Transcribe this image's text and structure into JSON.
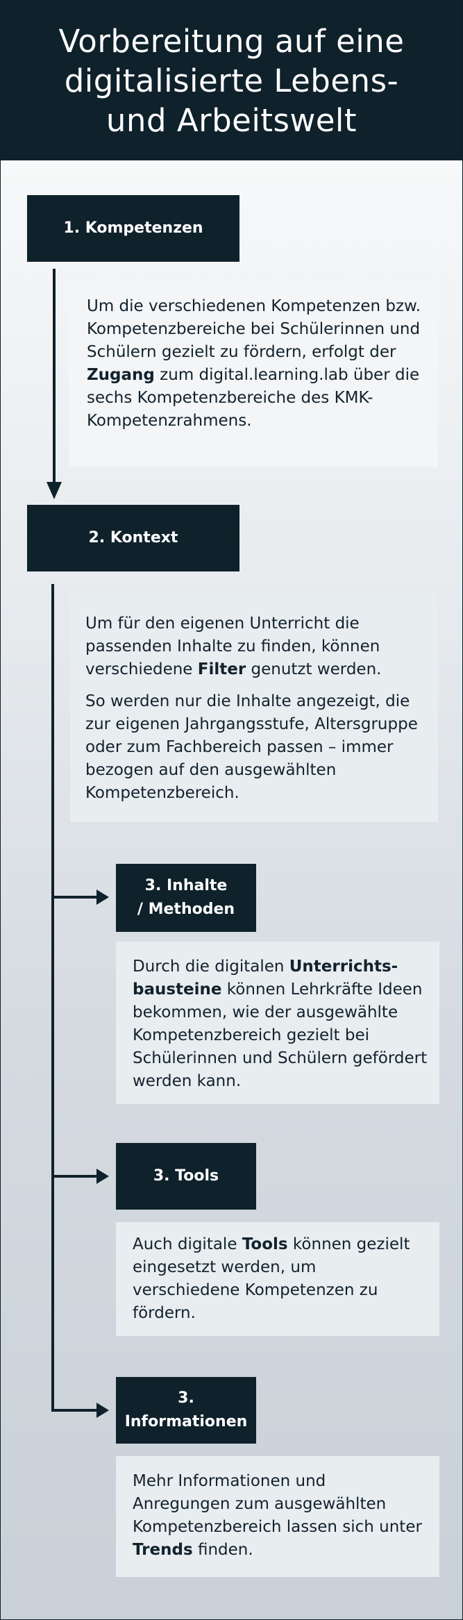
{
  "header": {
    "title": "Vorbereitung auf eine\ndigitalisierte Lebens-\nund Arbeitswelt"
  },
  "colors": {
    "dark": "#0f212b",
    "box": "#e8edf0",
    "text": "#12222c"
  },
  "steps": [
    {
      "label": "1. Kompetenzen",
      "paragraphs": [
        {
          "before": "Um die verschiedenen Kompetenzen bzw. Kompetenzbereiche bei Schülerinnen und Schülern gezielt zu fördern, erfolgt der ",
          "bold": "Zugang",
          "after": " zum digital.learning.lab über die sechs Kompetenzbereiche des KMK-Kompetenzrahmens."
        }
      ]
    },
    {
      "label": "2. Kontext",
      "paragraphs": [
        {
          "before": "Um für den eigenen Unterricht die passenden Inhalte zu finden, können verschiedene ",
          "bold": "Filter",
          "after": " genutzt werden."
        },
        {
          "before": "So werden nur die Inhalte angezeigt, die zur eigenen Jahrgangsstufe, Altersgruppe oder zum Fachbereich passen – immer bezogen auf den ausgewählten Kompetenzbereich.",
          "bold": "",
          "after": ""
        }
      ]
    },
    {
      "label": "3. Inhalte\n/ Methoden",
      "paragraphs": [
        {
          "before": "Durch die digitalen ",
          "bold": "Unterrichts-bausteine",
          "after": " können Lehrkräfte Ideen bekommen, wie der ausgewählte Kompetenzbereich gezielt bei Schülerinnen und Schülern gefördert werden kann."
        }
      ]
    },
    {
      "label": "3. Tools",
      "paragraphs": [
        {
          "before": "Auch digitale ",
          "bold": "Tools",
          "after": " können gezielt eingesetzt werden, um verschiedene Kompetenzen zu fördern."
        }
      ]
    },
    {
      "label": "3.\nInformationen",
      "paragraphs": [
        {
          "before": "Mehr Informationen und Anregungen zum ausgewählten Kompetenzbereich lassen sich unter ",
          "bold": "Trends",
          "after": " finden."
        }
      ]
    }
  ]
}
